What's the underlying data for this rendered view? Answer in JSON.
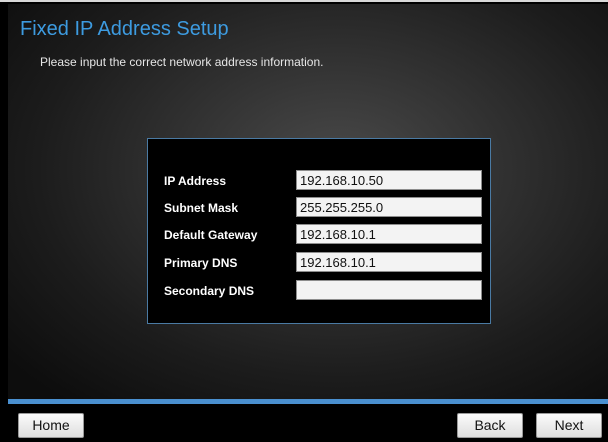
{
  "header": {
    "title": "Fixed IP Address Setup",
    "subtitle": "Please input the correct network address information."
  },
  "form": {
    "fields": [
      {
        "label": "IP Address",
        "value": "192.168.10.50"
      },
      {
        "label": "Subnet Mask",
        "value": "255.255.255.0"
      },
      {
        "label": "Default Gateway",
        "value": "192.168.10.1"
      },
      {
        "label": "Primary DNS",
        "value": "192.168.10.1"
      },
      {
        "label": "Secondary DNS",
        "value": ""
      }
    ]
  },
  "footer": {
    "home_label": "Home",
    "back_label": "Back",
    "next_label": "Next"
  },
  "colors": {
    "title": "#3d9be0",
    "accent_bar": "#4a90d0",
    "form_border": "#4a7aa3"
  }
}
